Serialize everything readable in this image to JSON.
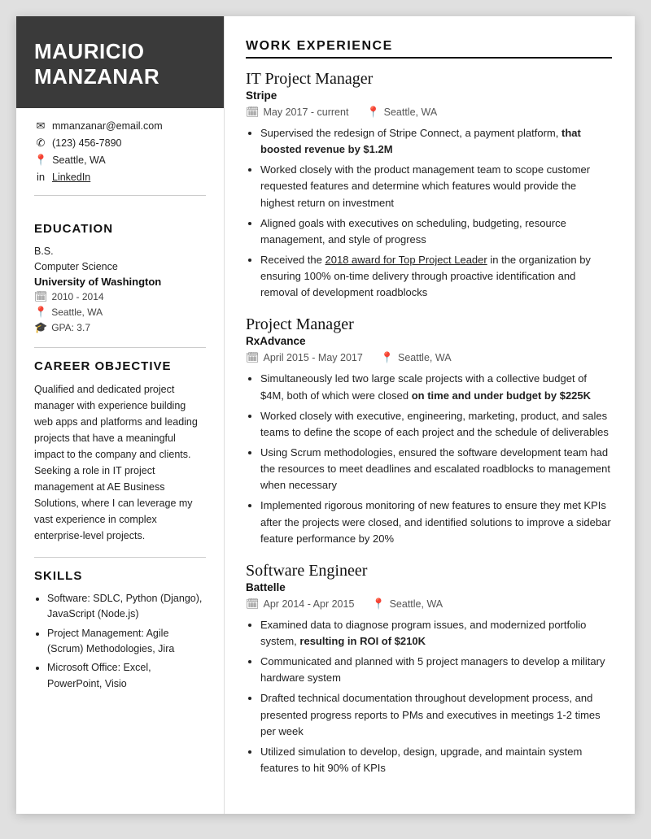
{
  "sidebar": {
    "name_line1": "MAURICIO",
    "name_line2": "MANZANAR",
    "contact": {
      "email": "mmanzanar@email.com",
      "phone": "(123) 456-7890",
      "location": "Seattle, WA",
      "linkedin": "LinkedIn"
    },
    "education": {
      "section_title": "EDUCATION",
      "degree": "B.S.",
      "field": "Computer Science",
      "school": "University of Washington",
      "years": "2010 - 2014",
      "location": "Seattle, WA",
      "gpa": "GPA: 3.7"
    },
    "career_objective": {
      "section_title": "CAREER OBJECTIVE",
      "text": "Qualified and dedicated project manager with experience building web apps and platforms and leading projects that have a meaningful impact to the company and clients. Seeking a role in IT project management at AE Business Solutions, where I can leverage my vast experience in complex enterprise-level projects."
    },
    "skills": {
      "section_title": "SKILLS",
      "items": [
        "Software: SDLC, Python (Django), JavaScript (Node.js)",
        "Project Management: Agile (Scrum) Methodologies, Jira",
        "Microsoft Office: Excel, PowerPoint, Visio"
      ]
    }
  },
  "main": {
    "work_experience_title": "WORK EXPERIENCE",
    "jobs": [
      {
        "title": "IT Project Manager",
        "company": "Stripe",
        "date": "May 2017 - current",
        "location": "Seattle, WA",
        "bullets": [
          {
            "text": "Supervised the redesign of Stripe Connect, a payment platform, ",
            "bold_suffix": "that boosted revenue by $1.2M"
          },
          {
            "text": "Worked closely with the product management team to scope customer requested features and determine which features would provide the highest return on investment"
          },
          {
            "text": "Aligned goals with executives on scheduling, budgeting, resource management, and style of progress"
          },
          {
            "text": "Received the ",
            "underline_part": "2018 award for Top Project Leader",
            "text_suffix": " in the organization by ensuring 100% on-time delivery through proactive identification and removal of development roadblocks"
          }
        ]
      },
      {
        "title": "Project Manager",
        "company": "RxAdvance",
        "date": "April 2015 - May 2017",
        "location": "Seattle, WA",
        "bullets": [
          {
            "text": "Simultaneously led two large scale projects with a collective budget of $4M, both of which were closed ",
            "bold_suffix": "on time and under budget by $225K"
          },
          {
            "text": "Worked closely with executive, engineering, marketing, product, and sales teams to define the scope of each project and the schedule of deliverables"
          },
          {
            "text": "Using Scrum methodologies, ensured the software development team had the resources to meet deadlines and escalated roadblocks to management when necessary"
          },
          {
            "text": "Implemented rigorous monitoring of new features to ensure they met KPIs after the projects were closed, and identified solutions to improve a sidebar feature performance by 20%"
          }
        ]
      },
      {
        "title": "Software Engineer",
        "company": "Battelle",
        "date": "Apr 2014 - Apr 2015",
        "location": "Seattle, WA",
        "bullets": [
          {
            "text": "Examined data to diagnose program issues, and modernized portfolio system, ",
            "bold_suffix": "resulting in ROI of $210K"
          },
          {
            "text": "Communicated and planned with 5 project managers to develop a military hardware system"
          },
          {
            "text": "Drafted technical documentation throughout development process, and presented progress reports to PMs and executives in meetings 1-2 times per week"
          },
          {
            "text": "Utilized simulation to develop, design, upgrade, and maintain system features to hit 90% of KPIs"
          }
        ]
      }
    ]
  }
}
